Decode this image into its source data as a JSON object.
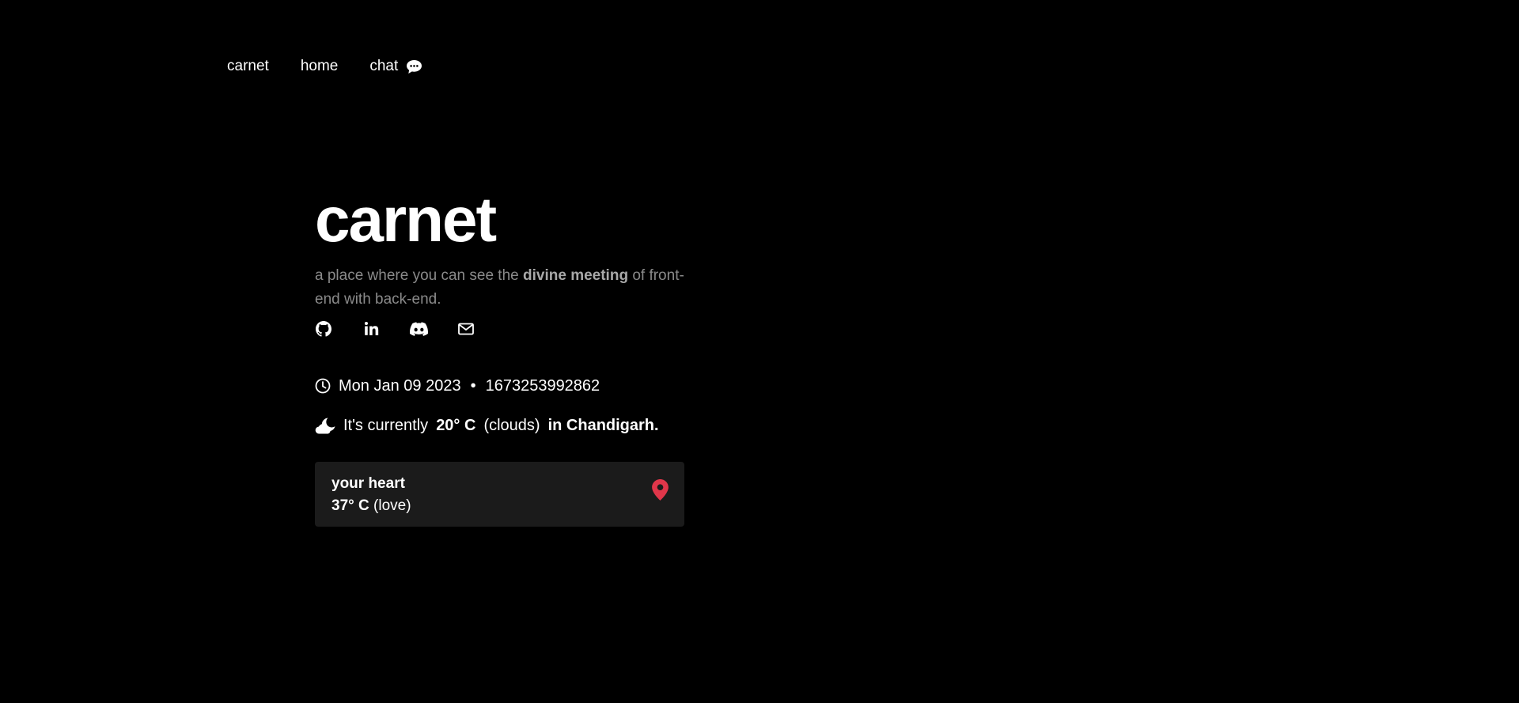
{
  "nav": {
    "brand": "carnet",
    "home": "home",
    "chat": "chat",
    "chat_icon": "speech-bubble-icon"
  },
  "hero": {
    "title": "carnet",
    "tagline_pre": "a place where you can see the ",
    "tagline_bold": "divine meeting",
    "tagline_post": " of front-end with back-end."
  },
  "socials": [
    {
      "name": "github-icon"
    },
    {
      "name": "linkedin-icon"
    },
    {
      "name": "discord-icon"
    },
    {
      "name": "mail-icon"
    }
  ],
  "time": {
    "icon": "clock-icon",
    "date": "Mon Jan 09 2023",
    "separator": "•",
    "timestamp": "1673253992862"
  },
  "weather": {
    "icon": "moon-cloud-icon",
    "prefix": "It's currently",
    "temp": "20° C",
    "condition": "(clouds)",
    "location": "in Chandigarh."
  },
  "card": {
    "title": "your heart",
    "temp": "37° C",
    "condition": "(love)",
    "icon": "location-pin-icon",
    "icon_color": "#e0364a"
  },
  "colors": {
    "background": "#000000",
    "text": "#ffffff",
    "muted": "#8a8a8a",
    "card_bg": "#1b1b1b",
    "accent": "#e0364a"
  }
}
